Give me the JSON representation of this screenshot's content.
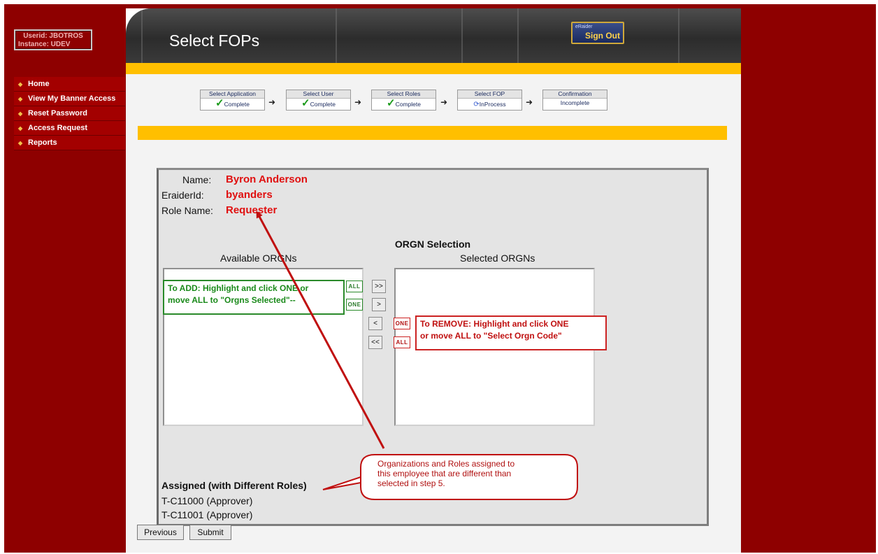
{
  "user": {
    "userid_label": "Userid: JBOTROS",
    "instance_label": "Instance: UDEV"
  },
  "nav": {
    "items": [
      {
        "label": "Home"
      },
      {
        "label": "View My Banner Access"
      },
      {
        "label": "Reset Password"
      },
      {
        "label": "Access Request"
      },
      {
        "label": "Reports"
      }
    ]
  },
  "header": {
    "title": "Select FOPs",
    "signout_small": "eRaider",
    "signout_label": "Sign Out"
  },
  "steps": [
    {
      "title": "Select Application",
      "status": "Complete",
      "icon": "check-icon"
    },
    {
      "title": "Select User",
      "status": "Complete",
      "icon": "check-icon"
    },
    {
      "title": "Select Roles",
      "status": "Complete",
      "icon": "check-icon"
    },
    {
      "title": "Select FOP",
      "status": "InProcess",
      "icon": "refresh-icon"
    },
    {
      "title": "Confirmation",
      "status": "Incomplete",
      "icon": ""
    }
  ],
  "person": {
    "name_label": "Name:",
    "name": "Byron Anderson",
    "eraider_label": "EraiderId:",
    "eraider": "byanders",
    "role_label": "Role Name:",
    "role": "Requester"
  },
  "orgn": {
    "heading": "ORGN Selection",
    "available_label": "Available ORGNs",
    "selected_label": "Selected ORGNs",
    "buttons": {
      "add_all": ">>",
      "add_one": ">",
      "remove_one": "<",
      "remove_all": "<<"
    },
    "tags": {
      "all": "ALL",
      "one": "ONE"
    },
    "add_callout": [
      "To ADD: Highlight and click ONE or",
      "move ALL to \"Orgns Selected\"--"
    ],
    "remove_callout": [
      "To REMOVE: Highlight and click ONE",
      "or move ALL to \"Select Orgn Code\""
    ]
  },
  "assigned": {
    "title": "Assigned (with Different Roles)",
    "items": [
      "T-C11000 (Approver)",
      "T-C11001 (Approver)"
    ]
  },
  "annotation": [
    "Organizations and Roles assigned to",
    "this employee that are different than",
    "selected in step 5."
  ],
  "actions": {
    "previous": "Previous",
    "submit": "Submit"
  },
  "colors": {
    "frame": "#8e0000",
    "gold": "#ffbf00",
    "highlight_red": "#e01010",
    "green": "#2a8a2a"
  }
}
